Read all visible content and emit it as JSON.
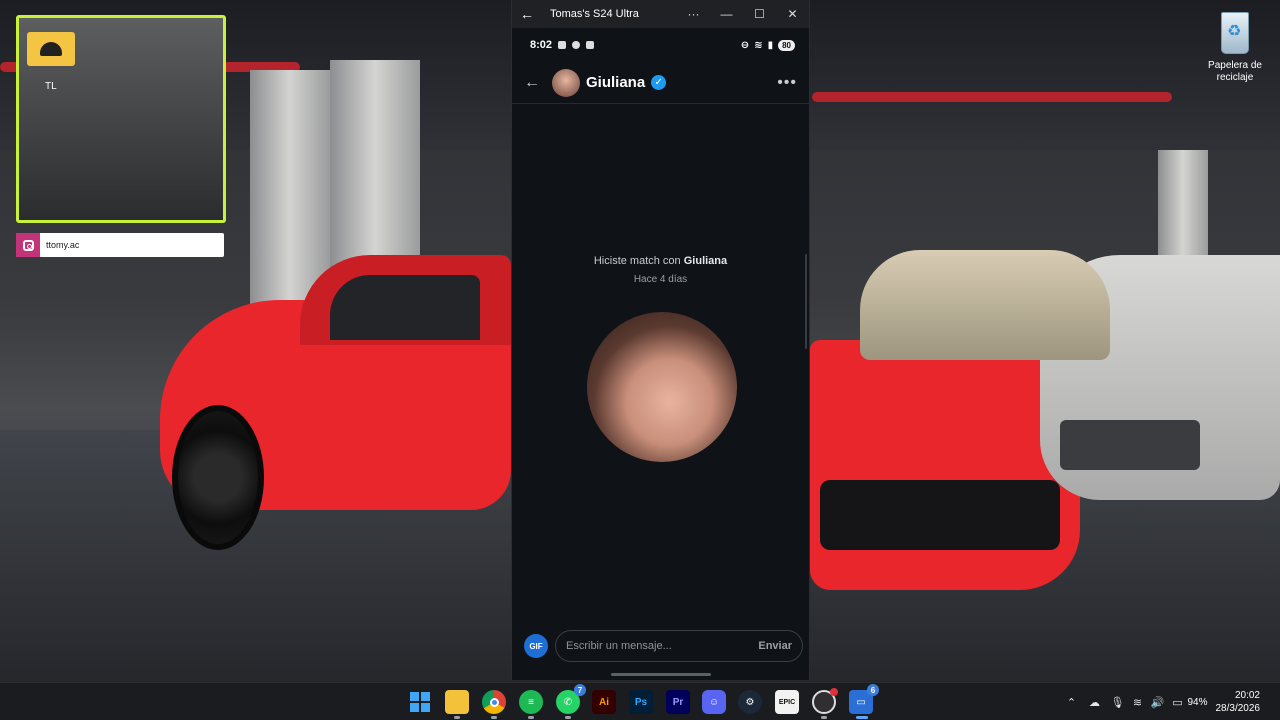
{
  "desktop": {
    "webcam_tag": "TL",
    "instagram_handle": "ttomy.ac",
    "recycle_bin_label": "Papelera de reciclaje"
  },
  "phone_window": {
    "title": "Tomas's S24 Ultra",
    "status": {
      "time": "8:02",
      "battery": "80"
    },
    "chat": {
      "contact_name": "Giuliana",
      "match_prefix": "Hiciste match con",
      "match_name": "Giuliana",
      "match_time": "Hace 4 días",
      "gif_label": "GIF",
      "message_placeholder": "Escribir un mensaje...",
      "send_label": "Enviar"
    }
  },
  "taskbar": {
    "apps": [
      {
        "name": "windows-start",
        "badge": ""
      },
      {
        "name": "file-explorer",
        "badge": ""
      },
      {
        "name": "chrome",
        "badge": ""
      },
      {
        "name": "spotify",
        "badge": ""
      },
      {
        "name": "whatsapp",
        "badge": "7"
      },
      {
        "name": "illustrator",
        "label": "Ai",
        "badge": ""
      },
      {
        "name": "photoshop",
        "label": "Ps",
        "badge": ""
      },
      {
        "name": "premiere",
        "label": "Pr",
        "badge": ""
      },
      {
        "name": "discord",
        "badge": ""
      },
      {
        "name": "steam",
        "badge": ""
      },
      {
        "name": "epic-games",
        "label": "EPIC",
        "badge": ""
      },
      {
        "name": "obs",
        "badge": ""
      },
      {
        "name": "phone-link",
        "badge": "6"
      }
    ],
    "tray": {
      "battery_percent": "94%",
      "time": "20:02",
      "date": "28/3/2026"
    }
  },
  "colors": {
    "webcam_border": "#c8f23a",
    "verified_blue": "#1d9bf0",
    "gif_blue": "#1d6fd6",
    "instagram_pink": "#c2337a"
  }
}
